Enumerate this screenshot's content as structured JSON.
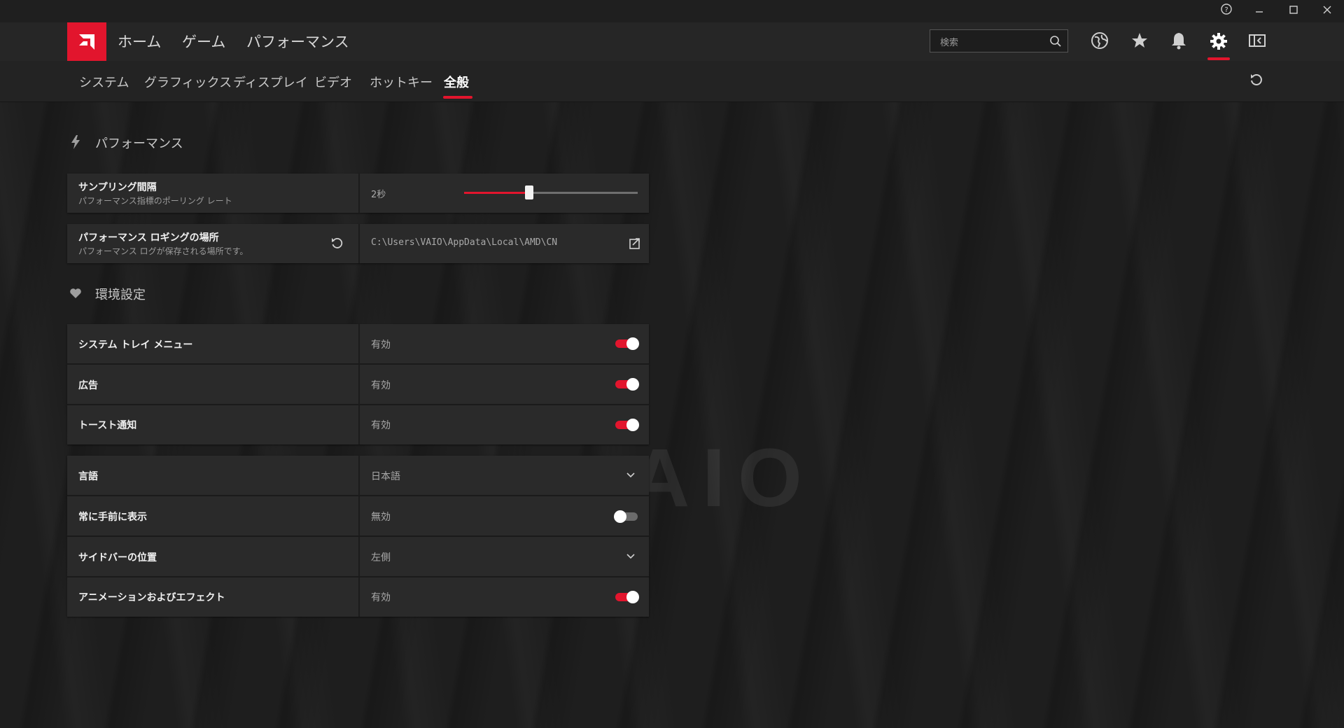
{
  "colors": {
    "accent": "#e2152d",
    "background": "#1c1c1c",
    "panel": "#2a2a2a"
  },
  "window": {
    "help_icon": "help-icon",
    "minimize": "minimize-icon",
    "maximize": "maximize-icon",
    "close": "close-icon"
  },
  "nav": {
    "items": [
      "ホーム",
      "ゲーム",
      "パフォーマンス"
    ],
    "search_placeholder": "検索",
    "icons": [
      "globe-icon",
      "star-icon",
      "bell-icon",
      "gear-icon",
      "sidebar-toggle-icon"
    ]
  },
  "subnav": {
    "tabs": [
      "システム",
      "グラフィックス",
      "ディスプレイ",
      "ビデオ",
      "ホットキー",
      "全般"
    ],
    "active": "全般"
  },
  "performance": {
    "title": "パフォーマンス",
    "sampling": {
      "name": "サンプリング間隔",
      "desc": "パフォーマンス指標のポーリング レート",
      "value": "2秒",
      "slider_level": 0.37
    },
    "logging": {
      "name": "パフォーマンス ロギングの場所",
      "desc": "パフォーマンス ログが保存される場所です。",
      "value": "C:\\Users\\VAIO\\AppData\\Local\\AMD\\CN"
    }
  },
  "preferences": {
    "title": "環境設定",
    "group1": [
      {
        "name": "システム トレイ メニュー",
        "value": "有効",
        "on": true
      },
      {
        "name": "広告",
        "value": "有効",
        "on": true
      },
      {
        "name": "トースト通知",
        "value": "有効",
        "on": true
      }
    ],
    "language": {
      "name": "言語",
      "value": "日本語"
    },
    "always_on_top": {
      "name": "常に手前に表示",
      "value": "無効",
      "on": false
    },
    "sidebar_position": {
      "name": "サイドバーの位置",
      "value": "左側"
    },
    "animations": {
      "name": "アニメーションおよびエフェクト",
      "value": "有効",
      "on": true
    }
  }
}
